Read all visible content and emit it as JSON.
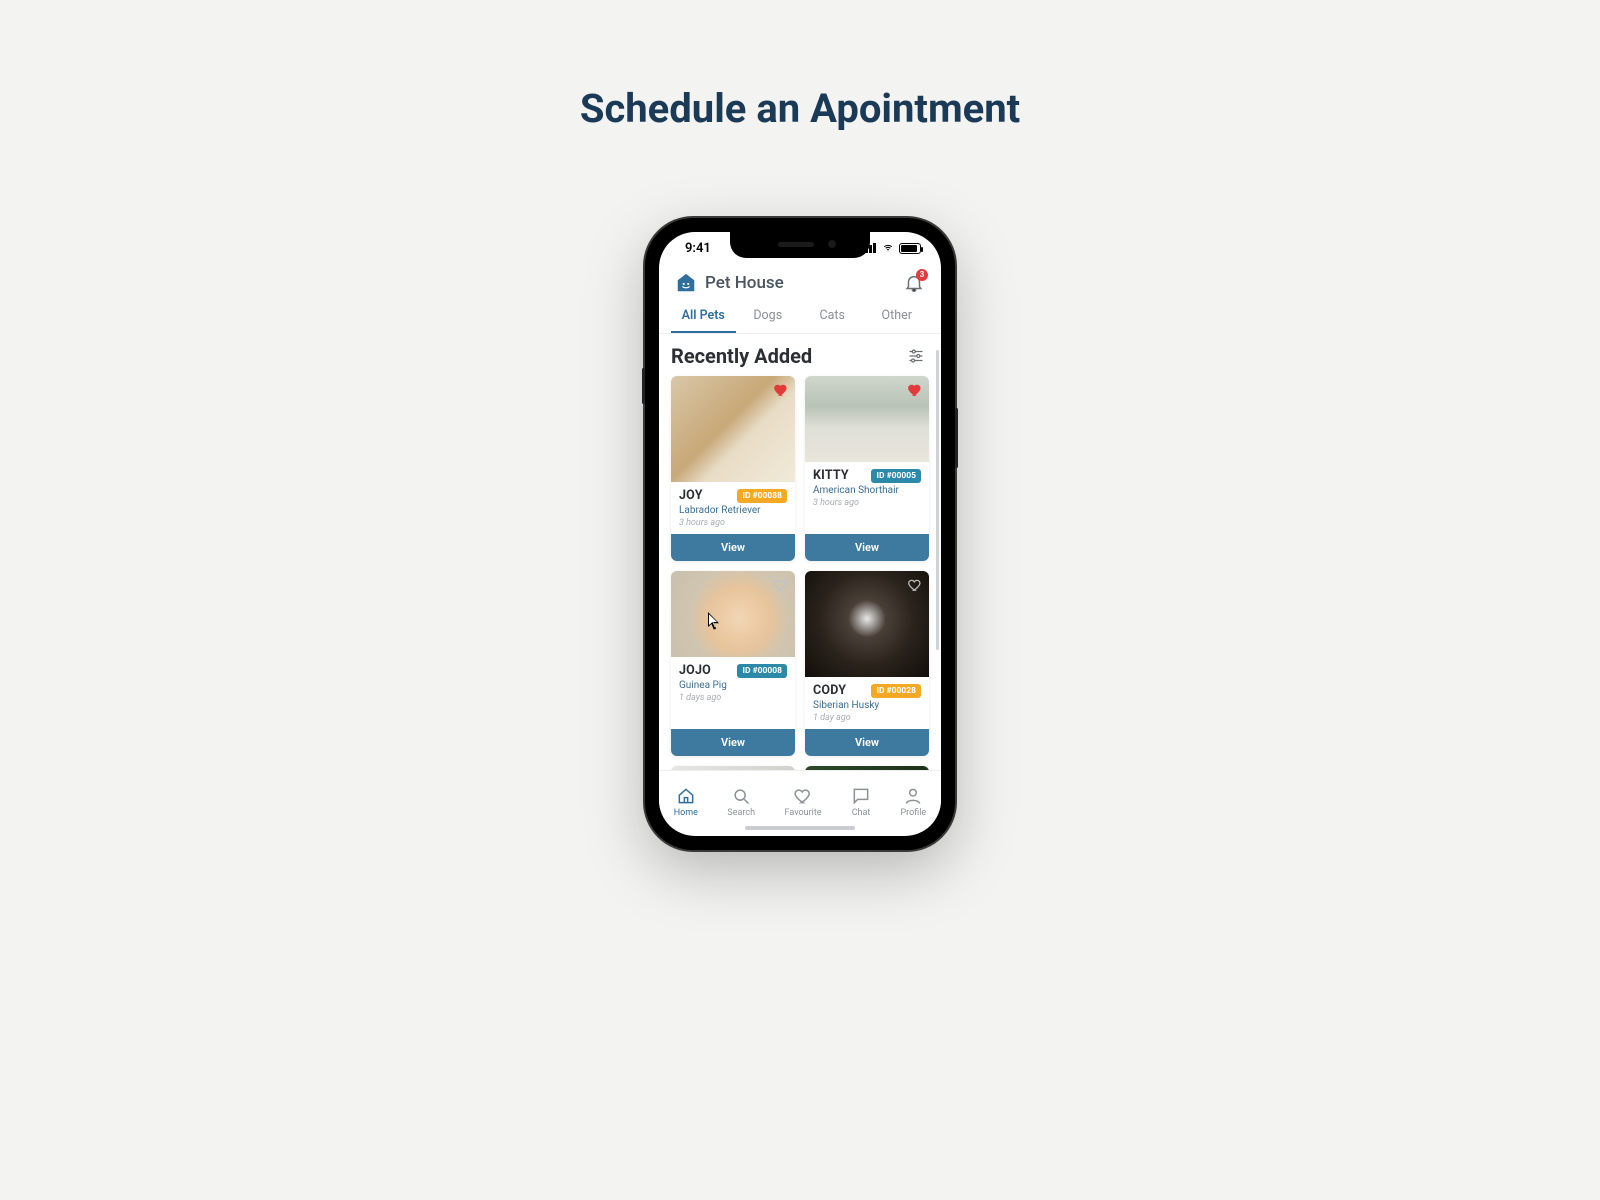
{
  "page": {
    "title": "Schedule an Apointment"
  },
  "status": {
    "time": "9:41"
  },
  "header": {
    "app_name": "Pet House",
    "notification_count": "3"
  },
  "tabs": [
    {
      "label": "All Pets",
      "active": true
    },
    {
      "label": "Dogs",
      "active": false
    },
    {
      "label": "Cats",
      "active": false
    },
    {
      "label": "Other",
      "active": false
    }
  ],
  "section": {
    "title": "Recently Added"
  },
  "pets": [
    {
      "name": "JOY",
      "id": "ID #00088",
      "id_style": "orange",
      "breed": "Labrador Retriever",
      "time": "3 hours ago",
      "favorited": true,
      "img": "img-joy",
      "tall": true,
      "view": "View"
    },
    {
      "name": "KITTY",
      "id": "ID #00005",
      "id_style": "teal",
      "breed": "American Shorthair",
      "time": "3 hours ago",
      "favorited": true,
      "img": "img-kitty",
      "tall": false,
      "view": "View"
    },
    {
      "name": "JOJO",
      "id": "ID #00008",
      "id_style": "teal",
      "breed": "Guinea Pig",
      "time": "1 days ago",
      "favorited": false,
      "img": "img-jojo",
      "tall": false,
      "view": "View"
    },
    {
      "name": "CODY",
      "id": "ID #00028",
      "id_style": "orange",
      "breed": "Siberian Husky",
      "time": "1 day ago",
      "favorited": false,
      "img": "img-cody",
      "tall": true,
      "view": "View"
    },
    {
      "name": "",
      "id": "",
      "id_style": "",
      "breed": "",
      "time": "",
      "favorited": false,
      "img": "img-p5",
      "tall": false,
      "partial": true,
      "view": ""
    },
    {
      "name": "",
      "id": "",
      "id_style": "",
      "breed": "",
      "time": "",
      "favorited": false,
      "img": "img-p6",
      "tall": false,
      "partial": true,
      "view": ""
    }
  ],
  "nav": [
    {
      "label": "Home",
      "active": true
    },
    {
      "label": "Search",
      "active": false
    },
    {
      "label": "Favourite",
      "active": false
    },
    {
      "label": "Chat",
      "active": false
    },
    {
      "label": "Profile",
      "active": false
    }
  ],
  "colors": {
    "accent": "#2f6f9e",
    "button": "#3e7aa0",
    "badge_orange": "#f4a925",
    "badge_teal": "#2c8aa8",
    "heart": "#e23b3b"
  }
}
